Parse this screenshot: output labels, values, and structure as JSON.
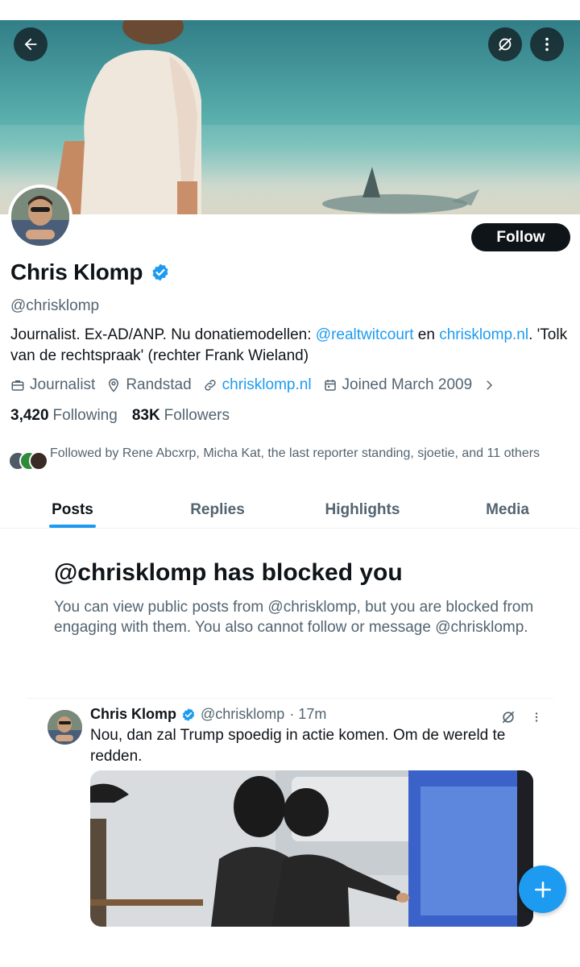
{
  "profile": {
    "name": "Chris Klomp",
    "handle": "@chrisklomp",
    "follow_label": "Follow",
    "bio_part1": "Journalist. Ex-AD/ANP. Nu donatiemodellen: ",
    "bio_link1": "@realtwitcourt",
    "bio_part2": " en ",
    "bio_link2": "chrisklomp.nl",
    "bio_part3": ". 'Tolk van de rechtspraak' (rechter Frank Wieland)",
    "profession": "Journalist",
    "location": "Randstad",
    "website": "chrisklomp.nl",
    "joined": "Joined March 2009",
    "following_count": "3,420",
    "following_label": "Following",
    "followers_count": "83K",
    "followers_label": "Followers",
    "followed_by": "Followed by Rene Abcxrp, Micha Kat, the last reporter standing, sjoetie, and 11 others"
  },
  "tabs": [
    {
      "label": "Posts",
      "active": true
    },
    {
      "label": "Replies",
      "active": false
    },
    {
      "label": "Highlights",
      "active": false
    },
    {
      "label": "Media",
      "active": false
    }
  ],
  "blocked": {
    "title": "@chrisklomp has blocked you",
    "text": "You can view public posts from @chrisklomp, but you are blocked from engaging with them. You also cannot follow or message @chrisklomp."
  },
  "post": {
    "name": "Chris Klomp",
    "handle": "@chrisklomp",
    "time": "· 17m",
    "text": "Nou, dan zal Trump spoedig in actie komen. Om de wereld te redden."
  },
  "colors": {
    "accent": "#1d9bf0",
    "text": "#0f1419",
    "secondary": "#536471",
    "follow_bg": "#0f1419"
  },
  "icons": {
    "back": "arrow-left-icon",
    "grok": "grok-icon",
    "more": "more-vertical-icon",
    "verified": "verified-badge-icon",
    "profession": "briefcase-icon",
    "location": "location-pin-icon",
    "website": "link-icon",
    "joined": "calendar-icon",
    "compose": "plus-icon"
  }
}
